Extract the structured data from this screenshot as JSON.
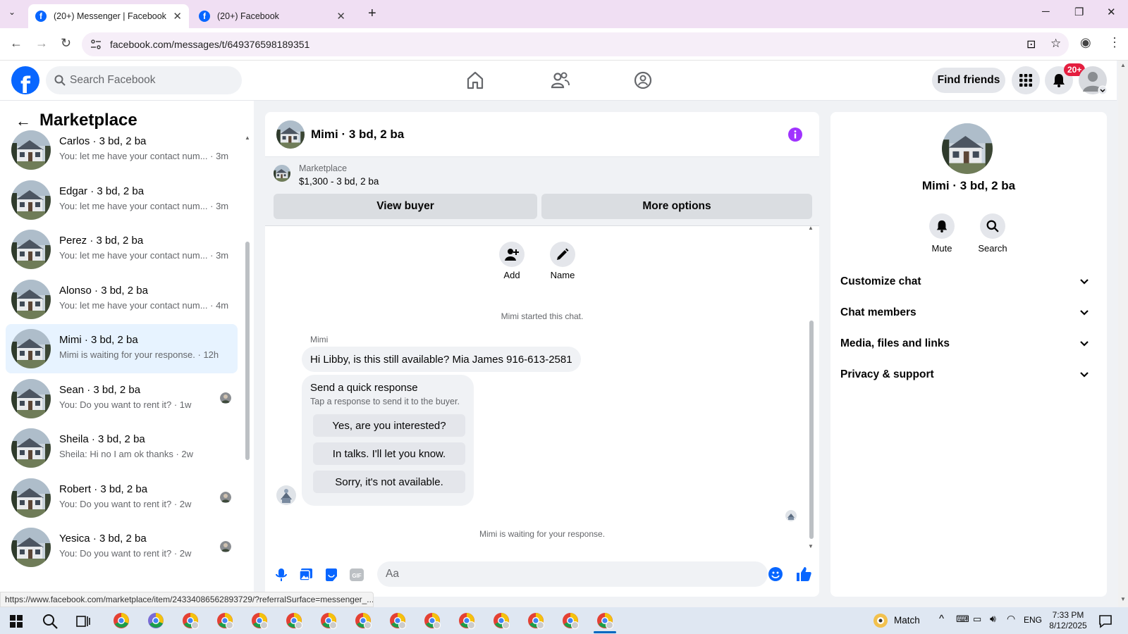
{
  "browser": {
    "tabs": [
      {
        "title": "(20+) Messenger | Facebook",
        "active": true
      },
      {
        "title": "(20+) Facebook",
        "active": false
      }
    ],
    "url": "facebook.com/messages/t/649376598189351",
    "status_url": "https://www.facebook.com/marketplace/item/24334086562893729/?referralSurface=messenger_..."
  },
  "fb_header": {
    "search_placeholder": "Search Facebook",
    "find_friends": "Find friends",
    "notification_badge": "20+"
  },
  "left_panel": {
    "title": "Marketplace",
    "conversations": [
      {
        "name": "Carlos · 3 bd, 2 ba",
        "preview": "You: let me have your contact num... · 3m",
        "selected": false,
        "seen_avatar": false
      },
      {
        "name": "Edgar · 3 bd, 2 ba",
        "preview": "You: let me have your contact num... · 3m",
        "selected": false,
        "seen_avatar": false
      },
      {
        "name": "Perez · 3 bd, 2 ba",
        "preview": "You: let me have your contact num... · 3m",
        "selected": false,
        "seen_avatar": false
      },
      {
        "name": "Alonso · 3 bd, 2 ba",
        "preview": "You: let me have your contact num... · 4m",
        "selected": false,
        "seen_avatar": false
      },
      {
        "name": "Mimi · 3 bd, 2 ba",
        "preview": "Mimi is waiting for your response. · 12h",
        "selected": true,
        "seen_avatar": false
      },
      {
        "name": "Sean · 3 bd, 2 ba",
        "preview": "You: Do you want to rent it? · 1w",
        "selected": false,
        "seen_avatar": true
      },
      {
        "name": "Sheila · 3 bd, 2 ba",
        "preview": "Sheila: Hi no I am ok thanks · 2w",
        "selected": false,
        "seen_avatar": false
      },
      {
        "name": "Robert · 3 bd, 2 ba",
        "preview": "You: Do you want to rent it? · 2w",
        "selected": false,
        "seen_avatar": true
      },
      {
        "name": "Yesica · 3 bd, 2 ba",
        "preview": "You: Do you want to rent it? · 2w",
        "selected": false,
        "seen_avatar": true
      }
    ]
  },
  "chat": {
    "title": "Mimi · 3 bd, 2 ba",
    "marketplace_label": "Marketplace",
    "listing": "$1,300 - 3 bd, 2 ba",
    "view_buyer": "View buyer",
    "more_options": "More options",
    "actions": [
      {
        "label": "Add"
      },
      {
        "label": "Name"
      }
    ],
    "started_text": "Mimi started this chat.",
    "sender_name": "Mimi",
    "message": "Hi Libby, is this still available? Mia James 916-613-2581",
    "quick_response": {
      "title": "Send a quick response",
      "subtitle": "Tap a response to send it to the buyer.",
      "options": [
        "Yes, are you interested?",
        "In talks. I'll let you know.",
        "Sorry, it's not available."
      ]
    },
    "waiting_text": "Mimi is waiting for your response.",
    "composer_placeholder": "Aa"
  },
  "right_panel": {
    "name": "Mimi · 3 bd, 2 ba",
    "actions": [
      {
        "label": "Mute"
      },
      {
        "label": "Search"
      }
    ],
    "sections": [
      "Customize chat",
      "Chat members",
      "Media, files and links",
      "Privacy & support"
    ]
  },
  "taskbar": {
    "weather_label": "Match",
    "language": "ENG",
    "time": "7:33 PM",
    "date": "8/12/2025"
  },
  "colors": {
    "fb_blue": "#0866ff",
    "info_purple": "#a033ff",
    "selected_row": "#e7f3ff",
    "badge_red": "#e41e3f"
  }
}
